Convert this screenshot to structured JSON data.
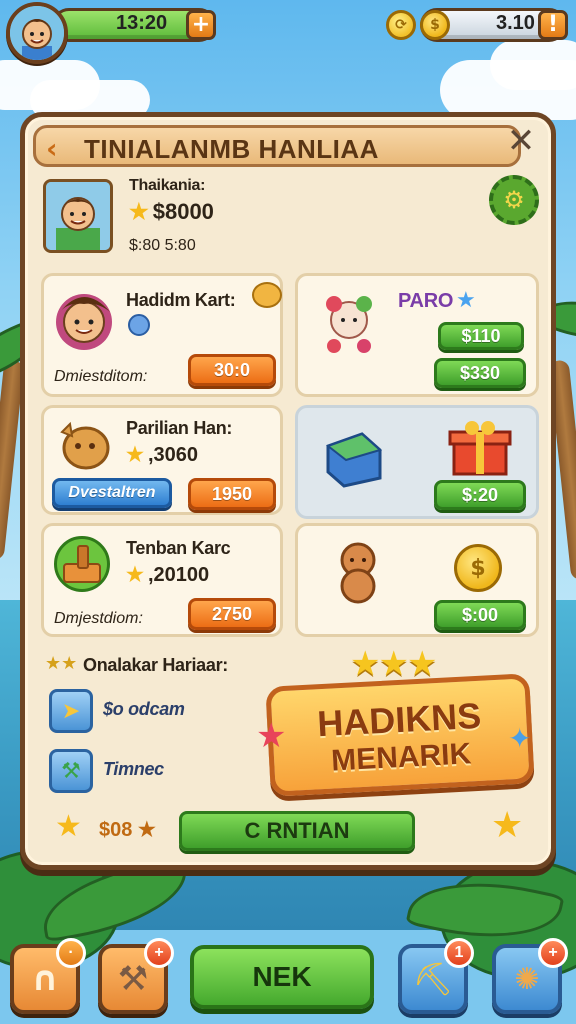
{
  "hud": {
    "level_value": "13:20",
    "coins_value": "3.10"
  },
  "panel": {
    "title": "TINIALANMB HANLIAA"
  },
  "profile": {
    "name": "Thaikania:",
    "price": "$8000",
    "subtext": "$:80 5:80"
  },
  "items": [
    {
      "name": "Hadidm Kart:",
      "subtext": "Dmiestditom:",
      "button": "30:0"
    },
    {
      "name": "Parilian Han:",
      "price": ",3060",
      "left_button": "Dvestaltren",
      "button": "1950"
    },
    {
      "name": "Tenban Karc",
      "price": ",20100",
      "subtext": "Dmjestdiom:",
      "button": "2750"
    }
  ],
  "right_cards": [
    {
      "label": "PARO",
      "buttons": [
        "$110",
        "$330"
      ]
    },
    {
      "button": "$:20"
    },
    {
      "button": "$:00"
    }
  ],
  "extras": {
    "heading": "Onalakar Hariaar:",
    "row1": "$o odcam",
    "row2": "Timnec",
    "bottom_price": "$08",
    "confirm_button": "C RNTIAN"
  },
  "banner": {
    "line1": "HADIKNS",
    "line2": "MENARIK"
  },
  "bottom_bar": {
    "next_label": "NEK",
    "badge_left": "",
    "badge_left2": "+",
    "badge_right1": "1",
    "badge_right2": "+"
  }
}
